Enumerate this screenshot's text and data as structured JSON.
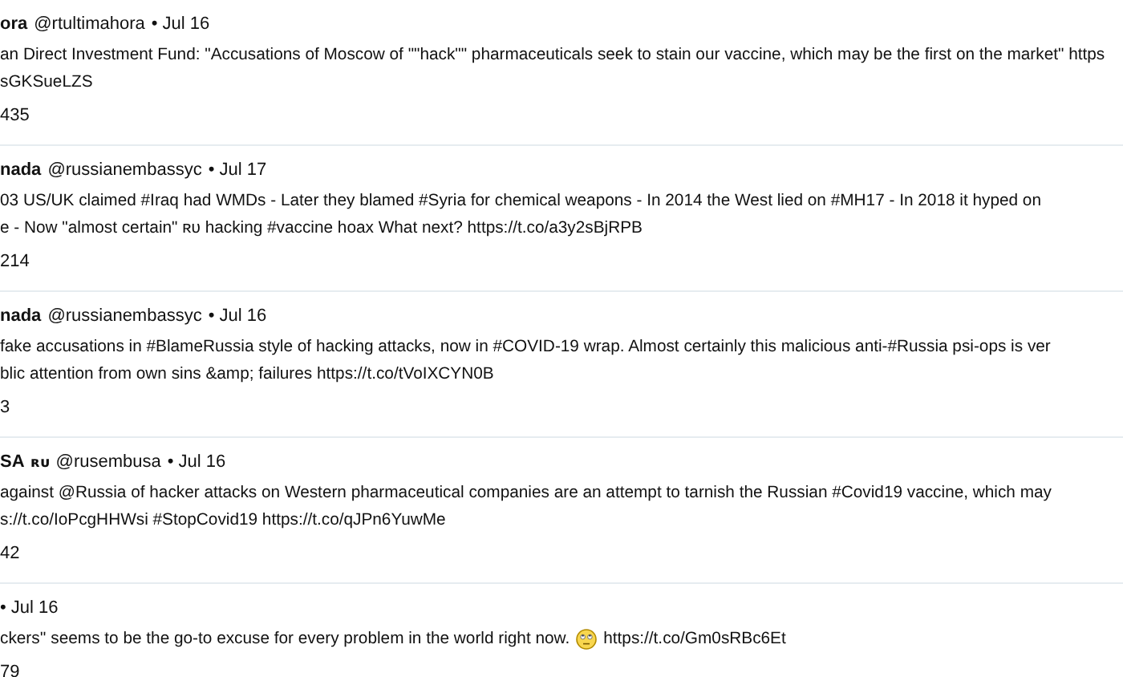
{
  "tweets": [
    {
      "name": "ora",
      "handle": "@rtultimahora",
      "date": "• Jul 16",
      "lines": [
        [
          {
            "kind": "text",
            "text": "an Direct Investment Fund: \"Accusations of Moscow of \"\"hack\"\" pharmaceuticals seek to stain our vaccine, which may be the first on the market\" https"
          }
        ],
        [
          {
            "kind": "text",
            "text": "sGKSueLZS"
          }
        ]
      ],
      "count": "435"
    },
    {
      "name": "nada",
      "handle": "@russianembassyc",
      "date": "• Jul 17",
      "lines": [
        [
          {
            "kind": "text",
            "text": "03 US/UK claimed #Iraq had WMDs - Later they blamed #Syria for chemical weapons - In 2014 the West lied on #MH17 - In 2018 it hyped on"
          }
        ],
        [
          {
            "kind": "text",
            "text": "e - Now \"almost certain\" ʀᴜ hacking #vaccine hoax What next? https://t.co/a3y2sBjRPB"
          }
        ]
      ],
      "count": "214"
    },
    {
      "name": "nada",
      "handle": "@russianembassyc",
      "date": "• Jul 16",
      "lines": [
        [
          {
            "kind": "text",
            "text": "fake accusations in #BlameRussia style of hacking attacks, now in #COVID-19 wrap. Almost certainly this malicious anti-#Russia psi-ops is ver"
          }
        ],
        [
          {
            "kind": "text",
            "text": "blic attention from own sins &amp; failures https://t.co/tVoIXCYN0B"
          }
        ]
      ],
      "count": "3"
    },
    {
      "name": "SA",
      "flag": "ʀᴜ",
      "handle": "@rusembusa",
      "date": "• Jul 16",
      "lines": [
        [
          {
            "kind": "text",
            "text": "against @Russia of hacker attacks on Western pharmaceutical companies are an attempt to tarnish the Russian #Covid19 vaccine, which may"
          }
        ],
        [
          {
            "kind": "text",
            "text": "s://t.co/IoPcgHHWsi #StopCovid19 https://t.co/qJPn6YuwMe"
          }
        ]
      ],
      "count": "42"
    },
    {
      "date": "• Jul 16",
      "lines": [
        [
          {
            "kind": "text",
            "text": "ckers'' seems to be the go-to excuse for every problem in the world right now."
          },
          {
            "kind": "emoji"
          },
          {
            "kind": "text",
            "text": "https://t.co/Gm0sRBc6Et"
          }
        ]
      ],
      "count": "79"
    }
  ]
}
